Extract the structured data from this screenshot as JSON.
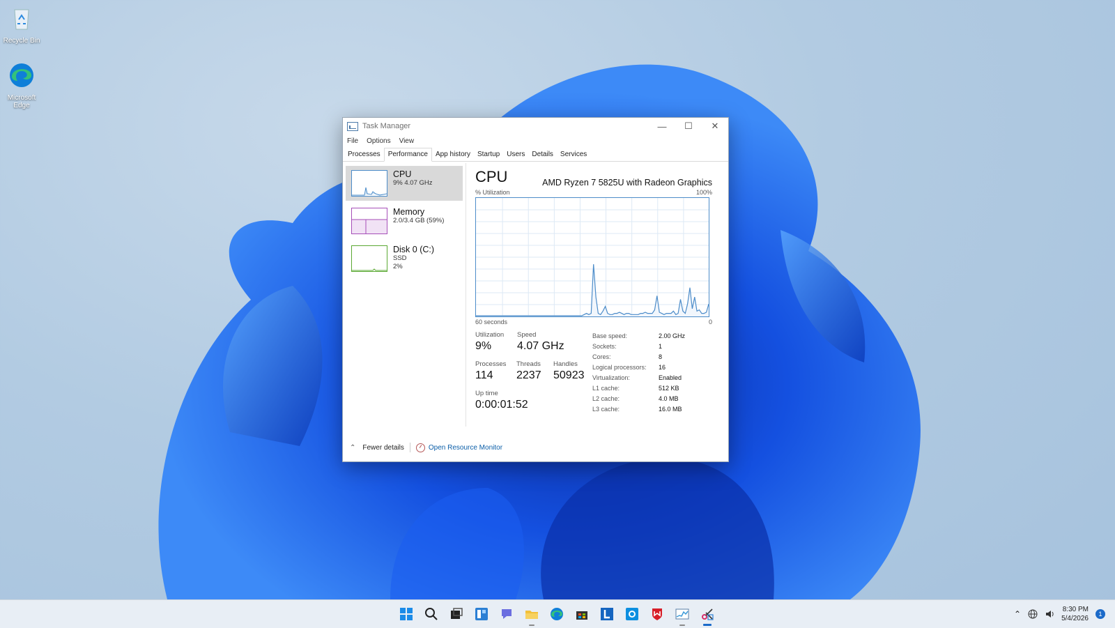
{
  "desktop": {
    "icons": [
      {
        "label": "Recycle Bin"
      },
      {
        "label": "Microsoft Edge"
      }
    ]
  },
  "window": {
    "title": "Task Manager",
    "menu": [
      "File",
      "Options",
      "View"
    ],
    "tabs": [
      "Processes",
      "Performance",
      "App history",
      "Startup",
      "Users",
      "Details",
      "Services"
    ],
    "active_tab": "Performance",
    "sidebar": [
      {
        "name": "CPU",
        "line1": "9% 4.07 GHz",
        "line2": "",
        "color": "#4c8cc9",
        "selected": true
      },
      {
        "name": "Memory",
        "line1": "2.0/3.4 GB (59%)",
        "line2": "",
        "color": "#a64eb8",
        "selected": false
      },
      {
        "name": "Disk 0 (C:)",
        "line1": "SSD",
        "line2": "2%",
        "color": "#5aa832",
        "selected": false
      }
    ],
    "cpu": {
      "title": "CPU",
      "model": "AMD Ryzen 7 5825U with Radeon Graphics",
      "util_label": "% Utilization",
      "util_max": "100%",
      "time_label": "60 seconds",
      "time_end": "0",
      "graph_values": [
        0,
        0,
        0,
        0,
        0,
        0,
        0,
        0,
        0,
        0,
        0,
        0,
        0,
        0,
        0,
        0,
        0,
        0,
        0,
        0,
        0,
        0,
        0,
        0,
        0,
        0,
        0,
        0,
        0,
        0,
        0,
        0,
        0,
        0,
        0,
        0,
        0,
        0,
        0,
        0,
        0,
        0,
        0,
        0,
        0,
        0,
        1,
        2,
        1,
        2,
        44,
        16,
        2,
        1,
        4,
        8,
        2,
        1,
        1,
        2,
        2,
        3,
        2,
        1,
        2,
        2,
        1,
        1,
        1,
        1,
        2,
        2,
        3,
        2,
        2,
        2,
        5,
        17,
        3,
        2,
        1,
        2,
        2,
        2,
        4,
        1,
        2,
        14,
        4,
        2,
        10,
        24,
        6,
        16,
        4,
        5,
        2,
        2,
        3,
        10
      ],
      "stats": {
        "utilization_label": "Utilization",
        "utilization": "9%",
        "speed_label": "Speed",
        "speed": "4.07 GHz",
        "processes_label": "Processes",
        "processes": "114",
        "threads_label": "Threads",
        "threads": "2237",
        "handles_label": "Handles",
        "handles": "50923",
        "uptime_label": "Up time",
        "uptime": "0:00:01:52"
      },
      "specs": [
        {
          "k": "Base speed:",
          "v": "2.00 GHz"
        },
        {
          "k": "Sockets:",
          "v": "1"
        },
        {
          "k": "Cores:",
          "v": "8"
        },
        {
          "k": "Logical processors:",
          "v": "16"
        },
        {
          "k": "Virtualization:",
          "v": "Enabled"
        },
        {
          "k": "L1 cache:",
          "v": "512 KB"
        },
        {
          "k": "L2 cache:",
          "v": "4.0 MB"
        },
        {
          "k": "L3 cache:",
          "v": "16.0 MB"
        }
      ]
    },
    "footer": {
      "fewer_details": "Fewer details",
      "resource_monitor": "Open Resource Monitor"
    }
  },
  "taskbar": {
    "apps": [
      "start-icon",
      "search-icon",
      "task-view-icon",
      "widgets-icon",
      "chat-icon",
      "file-explorer-icon",
      "edge-icon",
      "store-icon",
      "l-app-icon",
      "blue-app-icon",
      "mcafee-icon",
      "task-manager-icon",
      "snipping-tool-icon"
    ],
    "time": "8:30 PM",
    "date": "5/4/2026",
    "notifications": "1"
  }
}
